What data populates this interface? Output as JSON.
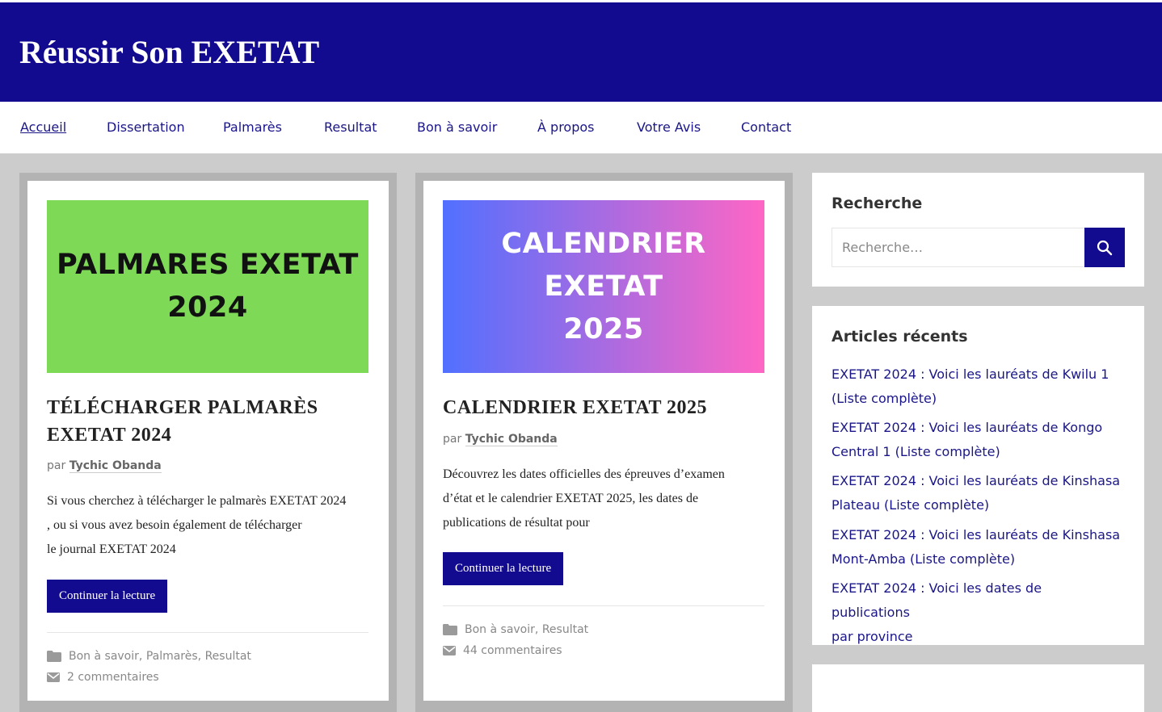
{
  "header": {
    "site_title": "Réussir Son EXETAT",
    "bg_color": "#120a8f"
  },
  "nav": {
    "items": [
      "Accueil",
      "Dissertation",
      "Palmarès",
      "Resultat",
      "Bon à savoir",
      "À propos",
      "Votre Avis",
      "Contact"
    ]
  },
  "posts": [
    {
      "thumb_line1": "PALMARES EXETAT",
      "thumb_line2": "2024",
      "title_line1": "TÉLÉCHARGER PALMARÈS",
      "title_line2": "EXETAT 2024",
      "by": "par",
      "author": "Tychic Obanda",
      "excerpt_line1": "Si vous cherchez à télécharger le palmarès EXETAT 2024",
      "excerpt_line2": ", ou si vous avez besoin également de télécharger",
      "excerpt_line3": "le journal EXETAT 2024",
      "more_label": "Continuer la lecture",
      "categories": [
        "Bon à savoir",
        "Palmarès",
        "Resultat"
      ],
      "comments": "2 commentaires"
    },
    {
      "thumb_line1": "CALENDRIER EXETAT",
      "thumb_line2": "2025",
      "title_line1": "CALENDRIER EXETAT 2025",
      "by": "par",
      "author": "Tychic Obanda",
      "excerpt_line1": "Découvrez les dates officielles des épreuves d’examen",
      "excerpt_line2": "d’état et le calendrier EXETAT 2025, les dates de",
      "excerpt_line3": "publications de résultat pour",
      "more_label": "Continuer la lecture",
      "categories": [
        "Bon à savoir",
        "Resultat"
      ],
      "comments": "44 commentaires"
    }
  ],
  "sidebar": {
    "search": {
      "title": "Recherche",
      "placeholder": "Recherche…"
    },
    "recent": {
      "title": "Articles récents",
      "items": [
        {
          "line1": "EXETAT 2024 : Voici les lauréats de Kwilu 1",
          "line2": "(Liste complète)"
        },
        {
          "line1": "EXETAT 2024 : Voici les lauréats de Kongo",
          "line2": "Central 1 (Liste complète)"
        },
        {
          "line1": "EXETAT 2024 : Voici les lauréats de Kinshasa",
          "line2": "Plateau (Liste complète)"
        },
        {
          "line1": "EXETAT 2024 : Voici les lauréats de Kinshasa",
          "line2": "Mont-Amba (Liste complète)"
        },
        {
          "line1": "EXETAT 2024 : Voici les dates de publications",
          "line2": "par province"
        }
      ]
    }
  },
  "colors": {
    "accent": "#120a8f",
    "link": "#1a1688",
    "page_bg": "#cccccc"
  },
  "icons": {
    "search": "search-icon",
    "category": "folder-icon",
    "comments": "envelope-icon"
  }
}
